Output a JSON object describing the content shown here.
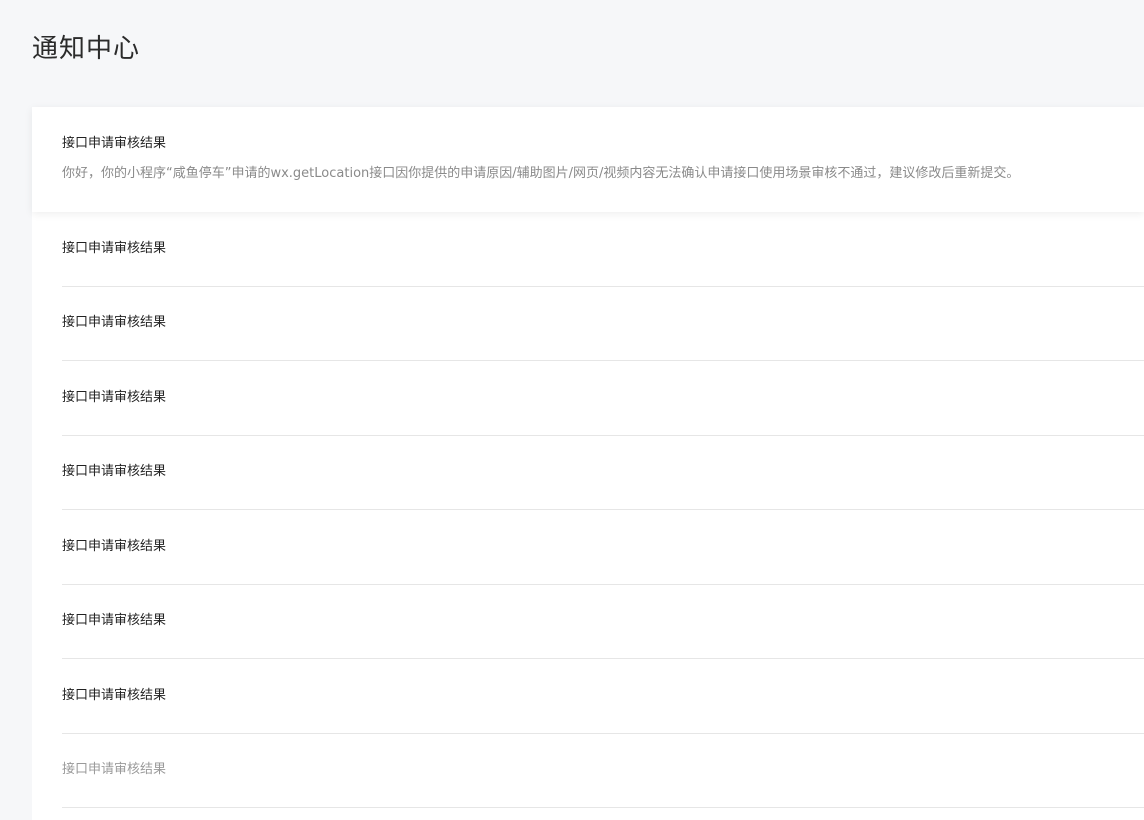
{
  "page": {
    "title": "通知中心"
  },
  "notifications": [
    {
      "title": "接口申请审核结果",
      "description": "你好，你的小程序“咸鱼停车”申请的wx.getLocation接口因你提供的申请原因/辅助图片/网页/视频内容无法确认申请接口使用场景审核不通过，建议修改后重新提交。",
      "expanded": true
    },
    {
      "title": "接口申请审核结果"
    },
    {
      "title": "接口申请审核结果"
    },
    {
      "title": "接口申请审核结果"
    },
    {
      "title": "接口申请审核结果"
    },
    {
      "title": "接口申请审核结果"
    },
    {
      "title": "接口申请审核结果"
    },
    {
      "title": "接口申请审核结果"
    },
    {
      "title": "接口申请审核结果",
      "read": true
    }
  ],
  "colors": {
    "background": "#f6f7f9",
    "panel": "#ffffff",
    "title_text": "#222222",
    "description_text": "#8a8a8a",
    "read_text": "#9a9a9a",
    "divider": "#e6e6e6"
  }
}
